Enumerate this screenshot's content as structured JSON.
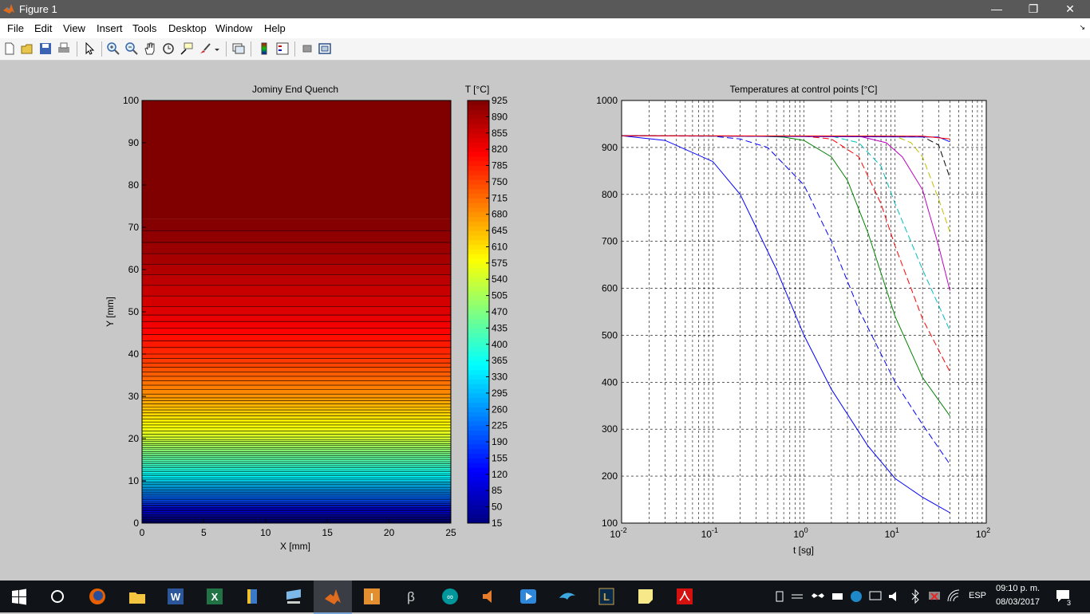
{
  "window": {
    "title": "Figure 1",
    "controls": {
      "minimize": "—",
      "restore": "❐",
      "close": "✕"
    }
  },
  "menu": [
    "File",
    "Edit",
    "View",
    "Insert",
    "Tools",
    "Desktop",
    "Window",
    "Help"
  ],
  "toolbar": {
    "buttons": [
      "new-figure-icon",
      "open-file-icon",
      "save-icon",
      "print-icon",
      "select-arrow-icon",
      "zoom-in-icon",
      "zoom-out-icon",
      "pan-hand-icon",
      "rotate-3d-icon",
      "data-cursor-icon",
      "brush-icon",
      "link-plot-icon",
      "colorbar-icon",
      "legend-icon",
      "hide-plot-tools-icon",
      "show-plot-tools-icon"
    ]
  },
  "chart_data": [
    {
      "type": "heatmap",
      "title": "Jominy End Quench",
      "xlabel": "X [mm]",
      "ylabel": "Y [mm]",
      "xlim": [
        0,
        25
      ],
      "ylim": [
        0,
        100
      ],
      "x_ticks": [
        "0",
        "5",
        "10",
        "15",
        "20",
        "25"
      ],
      "y_ticks": [
        "0",
        "10",
        "20",
        "30",
        "40",
        "50",
        "60",
        "70",
        "80",
        "90",
        "100"
      ],
      "colorbar": {
        "title": "T [°C]",
        "min": 15,
        "max": 925,
        "ticks": [
          "925",
          "890",
          "855",
          "820",
          "785",
          "750",
          "715",
          "680",
          "645",
          "610",
          "575",
          "540",
          "505",
          "470",
          "435",
          "400",
          "365",
          "330",
          "295",
          "260",
          "225",
          "190",
          "155",
          "120",
          "85",
          "50",
          "15"
        ]
      },
      "contour_step": 35,
      "temperature_profile": {
        "y_mm": [
          0,
          5,
          10,
          20,
          30,
          40,
          50,
          60,
          65,
          72,
          100
        ],
        "temperature_c": [
          15,
          190,
          330,
          540,
          680,
          775,
          840,
          880,
          900,
          925,
          925
        ]
      }
    },
    {
      "type": "line",
      "title": "Temperatures at control points [°C]",
      "xlabel": "t [sg]",
      "ylabel": "",
      "x_scale": "log",
      "xlim": [
        0.01,
        100
      ],
      "ylim": [
        100,
        1000
      ],
      "x_ticks": [
        {
          "base": "10",
          "exp": "-2"
        },
        {
          "base": "10",
          "exp": "-1"
        },
        {
          "base": "10",
          "exp": "0"
        },
        {
          "base": "10",
          "exp": "1"
        },
        {
          "base": "10",
          "exp": "2"
        }
      ],
      "y_ticks": [
        "100",
        "200",
        "300",
        "400",
        "500",
        "600",
        "700",
        "800",
        "900",
        "1000"
      ],
      "grid": true,
      "series": [
        {
          "color": "#0000ff",
          "dashed": false,
          "x": [
            0.01,
            0.03,
            0.1,
            0.2,
            0.5,
            1,
            2,
            5,
            10,
            20,
            40
          ],
          "y": [
            925,
            915,
            870,
            800,
            640,
            500,
            385,
            265,
            195,
            155,
            122
          ]
        },
        {
          "color": "#0000ff",
          "dashed": true,
          "x": [
            0.01,
            0.1,
            0.2,
            0.4,
            1,
            2,
            4,
            10,
            20,
            40
          ],
          "y": [
            925,
            924,
            918,
            900,
            820,
            700,
            555,
            400,
            310,
            225
          ]
        },
        {
          "color": "#008000",
          "dashed": false,
          "x": [
            0.01,
            0.3,
            0.6,
            1,
            2,
            3,
            5,
            10,
            20,
            40
          ],
          "y": [
            925,
            924,
            922,
            915,
            880,
            830,
            720,
            540,
            410,
            328
          ]
        },
        {
          "color": "#ff0000",
          "dashed": true,
          "x": [
            0.01,
            1,
            2,
            4,
            7,
            10,
            20,
            40
          ],
          "y": [
            925,
            924,
            918,
            880,
            780,
            690,
            535,
            422
          ]
        },
        {
          "color": "#00bfbf",
          "dashed": true,
          "x": [
            0.01,
            2,
            4,
            7,
            10,
            20,
            40
          ],
          "y": [
            925,
            924,
            910,
            860,
            780,
            640,
            510
          ]
        },
        {
          "color": "#bf00bf",
          "dashed": false,
          "x": [
            0.01,
            4,
            8,
            12,
            20,
            30,
            40
          ],
          "y": [
            925,
            924,
            910,
            880,
            810,
            690,
            595
          ]
        },
        {
          "color": "#bfbf00",
          "dashed": true,
          "x": [
            0.01,
            10,
            15,
            20,
            30,
            40
          ],
          "y": [
            925,
            924,
            910,
            880,
            790,
            720
          ]
        },
        {
          "color": "#000000",
          "dashed": true,
          "x": [
            0.01,
            20,
            30,
            40
          ],
          "y": [
            925,
            923,
            905,
            835
          ]
        },
        {
          "color": "#0000ff",
          "dashed": false,
          "x": [
            0.01,
            30,
            40
          ],
          "y": [
            925,
            922,
            912
          ]
        },
        {
          "color": "#ff0000",
          "dashed": false,
          "x": [
            0.01,
            20,
            40
          ],
          "y": [
            925,
            924,
            918
          ]
        }
      ]
    }
  ],
  "taskbar": {
    "apps": [
      "windows-start-icon",
      "cortana-circle-icon",
      "firefox-icon",
      "file-explorer-icon",
      "word-icon",
      "excel-icon",
      "folder-icon",
      "computer-icon",
      "matlab-icon",
      "inventor-icon",
      "pi-icon",
      "arduino-icon",
      "speaker-app-icon",
      "media-player-icon",
      "dolphin-icon",
      "league-icon",
      "sticky-notes-icon",
      "acrobat-icon"
    ],
    "language": "ESP",
    "time": "09:10 p. m.",
    "date": "08/03/2017",
    "notifications": "3"
  }
}
